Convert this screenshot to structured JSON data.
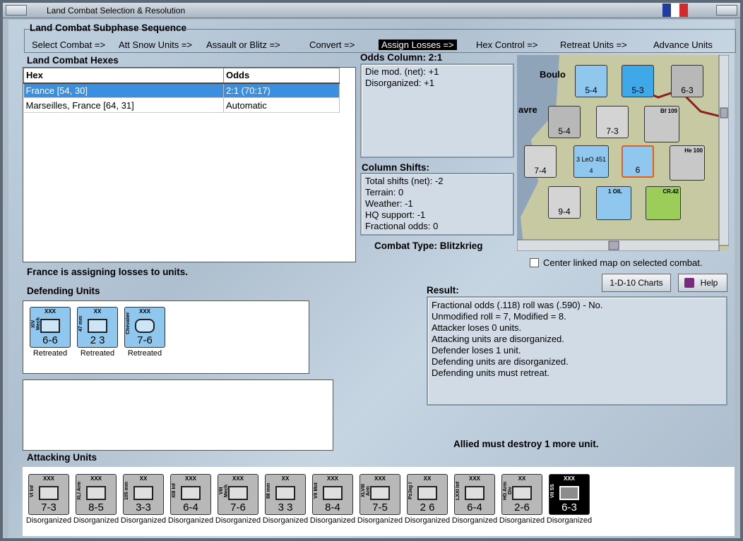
{
  "window": {
    "title": "Land Combat Selection & Resolution"
  },
  "sequence": {
    "title": "Land Combat Subphase Sequence",
    "steps": [
      "Select Combat =>",
      "Att Snow Units =>",
      "Assault or Blitz =>",
      "Convert =>",
      "Assign Losses =>",
      "Hex Control =>",
      "Retreat Units =>",
      "Advance Units"
    ],
    "active": "Assign Losses =>"
  },
  "hexes": {
    "title": "Land Combat Hexes",
    "col_hex": "Hex",
    "col_odds": "Odds",
    "rows": [
      {
        "hex": "France [54, 30]",
        "odds": "2:1 (70:17)"
      },
      {
        "hex": "Marseilles, France [64, 31]",
        "odds": "Automatic"
      }
    ]
  },
  "odds": {
    "title": "Odds Column: 2:1",
    "lines": [
      "Die mod. (net): +1",
      "Disorganized: +1"
    ]
  },
  "shifts": {
    "title": "Column Shifts:",
    "lines": [
      "Total shifts (net): -2",
      "Terrain: 0",
      "Weather: -1",
      "HQ support: -1",
      "Fractional odds: 0"
    ]
  },
  "combat_type": {
    "label": "Combat Type:",
    "value": "Blitzkrieg"
  },
  "status": "France is assigning losses to units.",
  "center_map": "Center linked map on selected combat.",
  "buttons": {
    "charts": "1-D-10 Charts",
    "help": "Help"
  },
  "result": {
    "title": "Result:",
    "lines": [
      "Fractional odds (.118) roll was (.590)  - No.",
      "Unmodified roll = 7, Modified = 8.",
      "Attacker loses 0 units.",
      "Attacking units are disorganized.",
      "Defender loses 1 unit.",
      "Defending units are disorganized.",
      "Defending units must retreat."
    ]
  },
  "must_destroy": "Allied must destroy 1 more unit.",
  "defending": {
    "title": "Defending Units",
    "units": [
      {
        "size": "XXX",
        "name": "XIV Mech",
        "str": "6-6",
        "cap": "Retreated"
      },
      {
        "size": "XX",
        "name": "47 mm",
        "str": "2 3",
        "cap": "Retreated"
      },
      {
        "size": "XXX",
        "name": "Chevalier",
        "str": "7-6",
        "cap": "Retreated"
      }
    ]
  },
  "attacking": {
    "title": "Attacking Units",
    "units": [
      {
        "size": "XXX",
        "name": "VI Inf",
        "str": "7-3",
        "cap": "Disorganized"
      },
      {
        "size": "XXX",
        "name": "XLI Arm",
        "str": "8-5",
        "cap": "Disorganized"
      },
      {
        "size": "XX",
        "name": "105 mm",
        "str": "3-3",
        "cap": "Disorganized"
      },
      {
        "size": "XXX",
        "name": "XIII Inf",
        "str": "6-4",
        "cap": "Disorganized"
      },
      {
        "size": "XXX",
        "name": "VIII Mech",
        "str": "7-6",
        "cap": "Disorganized"
      },
      {
        "size": "XX",
        "name": "88 mm",
        "str": "3 3",
        "cap": "Disorganized"
      },
      {
        "size": "XXX",
        "name": "VII Mot",
        "str": "8-4",
        "cap": "Disorganized"
      },
      {
        "size": "XXX",
        "name": "XLVIII Arm",
        "str": "7-5",
        "cap": "Disorganized"
      },
      {
        "size": "XX",
        "name": "PzJag I",
        "str": "2 6",
        "cap": "Disorganized"
      },
      {
        "size": "XXX",
        "name": "LXXI Inf",
        "str": "6-4",
        "cap": "Disorganized"
      },
      {
        "size": "XX",
        "name": "HG Arm Div",
        "str": "2-6",
        "cap": "Disorganized"
      },
      {
        "size": "XXX",
        "name": "VII SS",
        "str": "6-3",
        "cap": "Disorganized"
      }
    ]
  },
  "map": {
    "place": "Boulo",
    "place2": "avre",
    "oil": "1 OIL",
    "units": [
      "5-4",
      "5-3",
      "6-3",
      "5-4",
      "7-3",
      "7-4",
      "9-4",
      "6",
      "3 LeO 451 4",
      "Bf 109",
      "He 100",
      "CR.42"
    ]
  },
  "colors": {
    "defender": "#8fc7ee",
    "attacker": "#b8b8b8",
    "elite": "#000000",
    "active_row": "#3b8fe0"
  }
}
